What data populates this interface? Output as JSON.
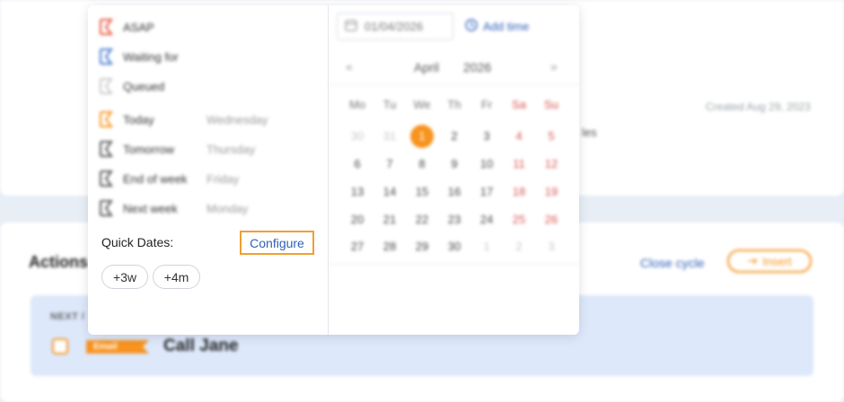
{
  "background": {
    "created": "Created Aug 29, 2023",
    "snippet": "les",
    "actions_heading": "Actions",
    "close_cycle": "Close cycle",
    "insert": "Insert",
    "next_label": "NEXT /",
    "task_badge": "Email",
    "task_title": "Call Jane"
  },
  "options": [
    {
      "label": "ASAP",
      "day": "",
      "color": "#e8553d"
    },
    {
      "label": "Waiting for",
      "day": "",
      "color": "#4a7bd0"
    },
    {
      "label": "Queued",
      "day": "",
      "color": "#c8c8c8"
    },
    {
      "label": "Today",
      "day": "Wednesday",
      "color": "#f7931e"
    },
    {
      "label": "Tomorrow",
      "day": "Thursday",
      "color": "#555555"
    },
    {
      "label": "End of week",
      "day": "Friday",
      "color": "#555555"
    },
    {
      "label": "Next week",
      "day": "Monday",
      "color": "#555555"
    }
  ],
  "quick_dates": {
    "label": "Quick Dates:",
    "configure": "Configure",
    "chips": [
      "+3w",
      "+4m"
    ]
  },
  "calendar": {
    "date_value": "01/04/2026",
    "add_time": "Add time",
    "month": "April",
    "year": "2026",
    "prev": "«",
    "next": "»",
    "weekdays": [
      "Mo",
      "Tu",
      "We",
      "Th",
      "Fr",
      "Sa",
      "Su"
    ],
    "weeks": [
      [
        "30",
        "31",
        "1",
        "2",
        "3",
        "4",
        "5"
      ],
      [
        "6",
        "7",
        "8",
        "9",
        "10",
        "11",
        "12"
      ],
      [
        "13",
        "14",
        "15",
        "16",
        "17",
        "18",
        "19"
      ],
      [
        "20",
        "21",
        "22",
        "23",
        "24",
        "25",
        "26"
      ],
      [
        "27",
        "28",
        "29",
        "30",
        "1",
        "2",
        "3"
      ]
    ],
    "selected": "1"
  }
}
